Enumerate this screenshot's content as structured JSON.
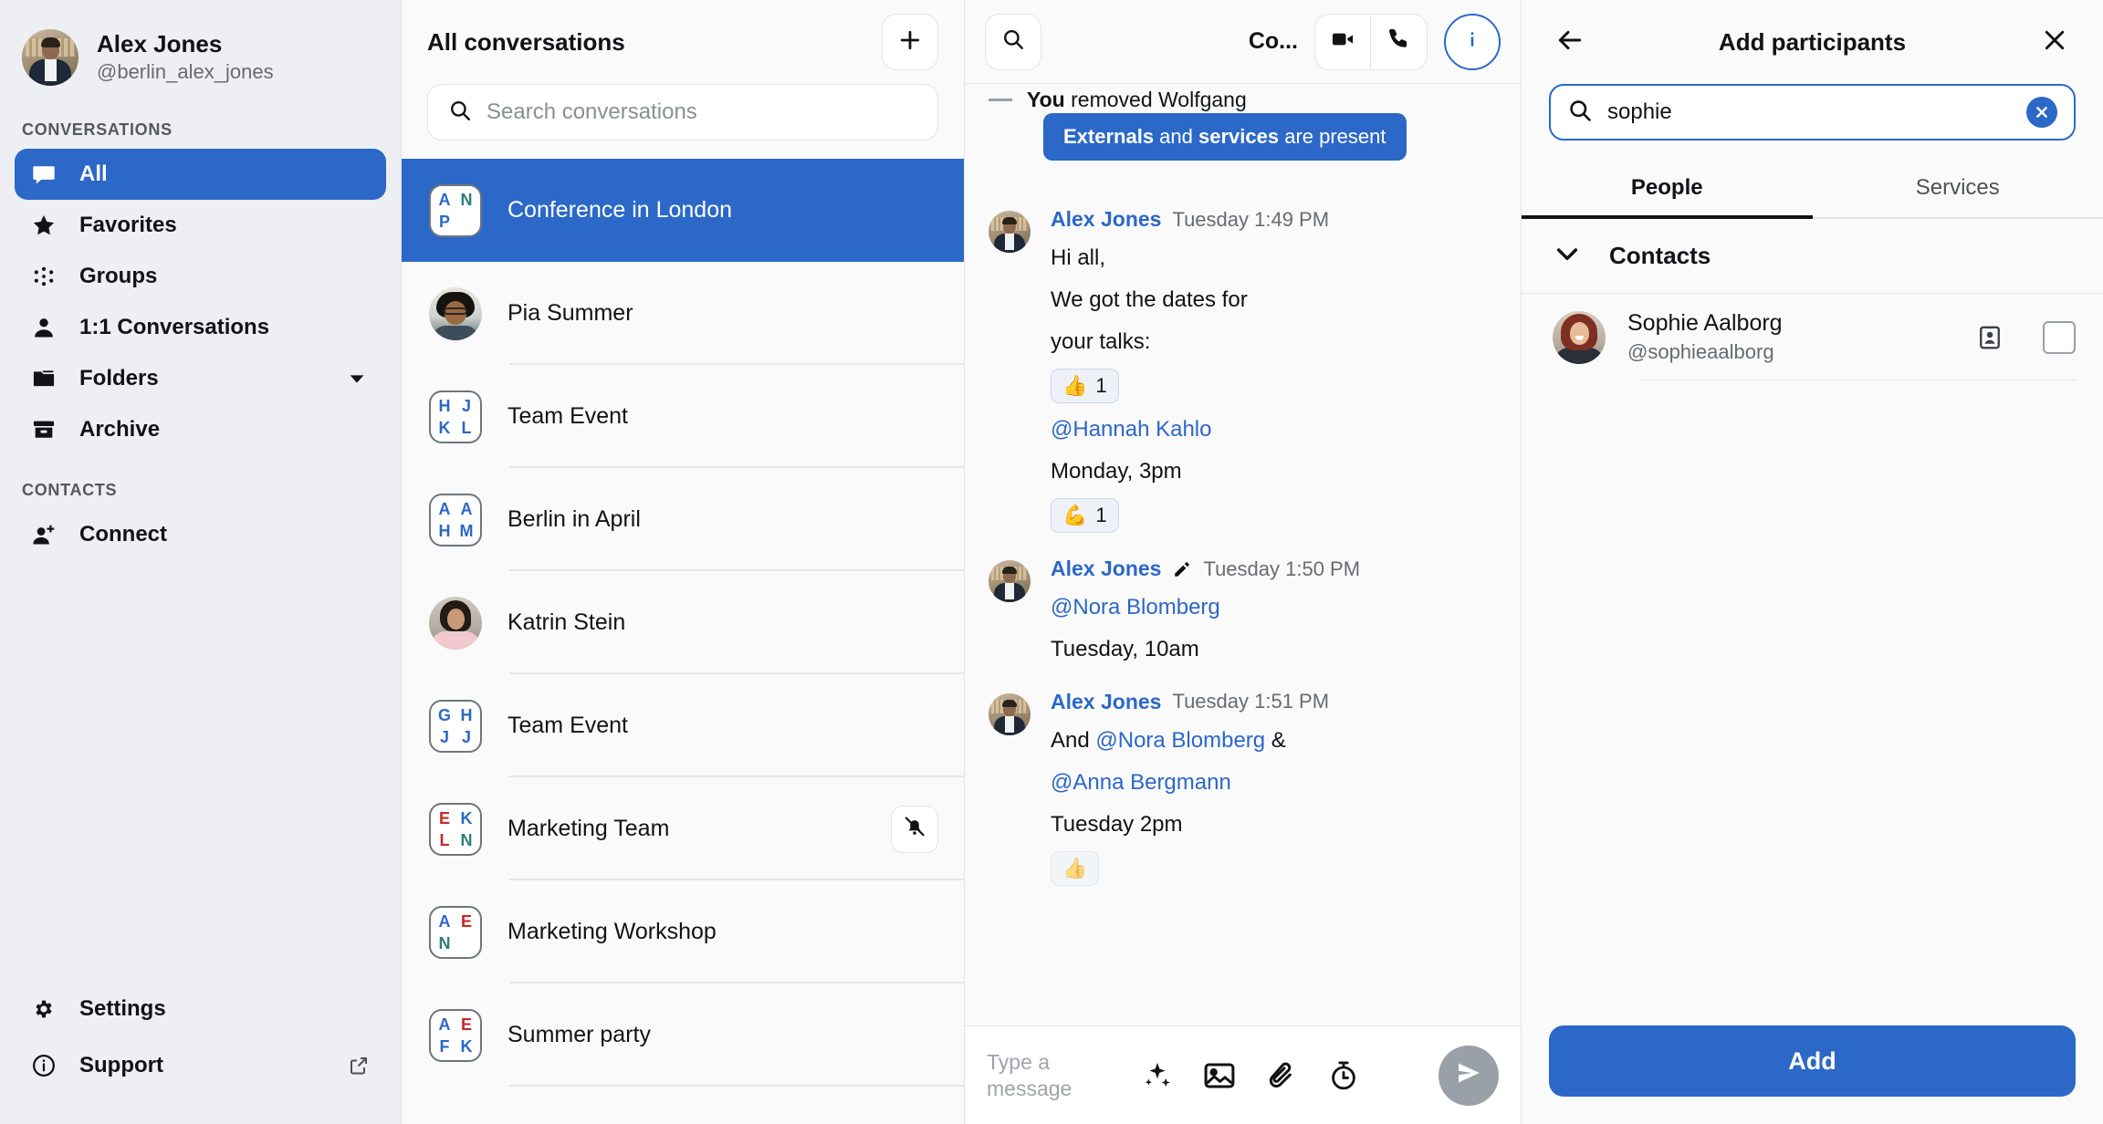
{
  "colors": {
    "accent": "#2b68c8",
    "sidebar_bg": "#edeff2",
    "panel_bg": "#fafafa",
    "muted_text": "#676b71"
  },
  "sidebar": {
    "profile": {
      "name": "Alex Jones",
      "handle": "@berlin_alex_jones",
      "avatar": "user-photo"
    },
    "conversations_label": "CONVERSATIONS",
    "contacts_label": "CONTACTS",
    "items": [
      {
        "label": "All",
        "icon": "chat-bubble-icon",
        "active": true
      },
      {
        "label": "Favorites",
        "icon": "star-icon",
        "active": false
      },
      {
        "label": "Groups",
        "icon": "groups-icon",
        "active": false
      },
      {
        "label": "1:1 Conversations",
        "icon": "person-icon",
        "active": false
      },
      {
        "label": "Folders",
        "icon": "folder-icon",
        "active": false,
        "chevron": "chevron-down-icon"
      },
      {
        "label": "Archive",
        "icon": "archive-icon",
        "active": false
      }
    ],
    "contacts_items": [
      {
        "label": "Connect",
        "icon": "person-add-icon"
      }
    ],
    "bottom_items": [
      {
        "label": "Settings",
        "icon": "gear-icon"
      },
      {
        "label": "Support",
        "icon": "info-circle-icon",
        "external": "external-link-icon"
      }
    ]
  },
  "convlist": {
    "title": "All conversations",
    "add_button": "plus-icon",
    "search": {
      "placeholder": "Search conversations",
      "value": "",
      "icon": "search-icon"
    },
    "items": [
      {
        "name": "Conference in London",
        "avatar_type": "initials",
        "initials": [
          "A",
          "N",
          "P"
        ],
        "initial_colors": [
          "#2b68c8",
          "#2e7d7a",
          "#2b68c8"
        ],
        "selected": true
      },
      {
        "name": "Pia Summer",
        "avatar_type": "photo",
        "photo": "pia-avatar",
        "selected": false
      },
      {
        "name": "Team Event",
        "avatar_type": "initials",
        "initials": [
          "H",
          "J",
          "K",
          "L"
        ],
        "initial_colors": [
          "#2b68c8",
          "#2b68c8",
          "#2b68c8",
          "#2b68c8"
        ],
        "selected": false
      },
      {
        "name": "Berlin in April",
        "avatar_type": "initials",
        "initials": [
          "A",
          "A",
          "H",
          "M"
        ],
        "initial_colors": [
          "#2b68c8",
          "#2b68c8",
          "#2b68c8",
          "#2b68c8"
        ],
        "selected": false
      },
      {
        "name": "Katrin Stein",
        "avatar_type": "photo",
        "photo": "katrin-avatar",
        "selected": false
      },
      {
        "name": "Team Event",
        "avatar_type": "initials",
        "initials": [
          "G",
          "H",
          "J",
          "J"
        ],
        "initial_colors": [
          "#2b68c8",
          "#2b68c8",
          "#2b68c8",
          "#2b68c8"
        ],
        "selected": false
      },
      {
        "name": "Marketing Team",
        "avatar_type": "initials",
        "initials": [
          "E",
          "K",
          "L",
          "N"
        ],
        "initial_colors": [
          "#c62828",
          "#2b68c8",
          "#c62828",
          "#2e7d7a"
        ],
        "selected": false,
        "muted": true,
        "mute_icon": "bell-off-icon"
      },
      {
        "name": "Marketing Workshop",
        "avatar_type": "initials",
        "initials": [
          "A",
          "E",
          "N"
        ],
        "initial_colors": [
          "#2b68c8",
          "#c62828",
          "#2e7d7a"
        ],
        "selected": false
      },
      {
        "name": "Summer party",
        "avatar_type": "initials",
        "initials": [
          "A",
          "E",
          "F",
          "K"
        ],
        "initial_colors": [
          "#2b68c8",
          "#c62828",
          "#2b68c8",
          "#2b68c8"
        ],
        "selected": false
      }
    ]
  },
  "chat": {
    "header": {
      "search_icon": "search-icon",
      "title": "Co...",
      "video_call_icon": "video-camera-icon",
      "audio_call_icon": "phone-icon",
      "info_icon": "info-circle-icon"
    },
    "system_message": {
      "prefix": "You",
      "rest": " removed Wolfgang"
    },
    "banner": {
      "bold1": "Externals",
      "mid": " and ",
      "bold2": "services",
      "tail": " are present"
    },
    "messages": [
      {
        "sender": "Alex Jones",
        "time": "Tuesday 1:49 PM",
        "edited": false,
        "lines": [
          {
            "type": "text",
            "text": "Hi all,"
          },
          {
            "type": "text",
            "text": "We got the dates for"
          },
          {
            "type": "text",
            "text": "your talks:"
          },
          {
            "type": "reaction",
            "emoji": "👍",
            "count": "1"
          },
          {
            "type": "mention",
            "text": "@Hannah Kahlo"
          },
          {
            "type": "text",
            "text": "Monday, 3pm"
          },
          {
            "type": "reaction",
            "emoji": "💪",
            "count": "1"
          }
        ]
      },
      {
        "sender": "Alex Jones",
        "time": "Tuesday 1:50 PM",
        "edited": true,
        "edit_icon": "pencil-icon",
        "lines": [
          {
            "type": "mention",
            "text": "@Nora Blomberg"
          },
          {
            "type": "text",
            "text": "Tuesday, 10am"
          }
        ]
      },
      {
        "sender": "Alex Jones",
        "time": "Tuesday 1:51 PM",
        "edited": false,
        "lines": [
          {
            "type": "mixed",
            "pre": "And ",
            "mention": "@Nora Blomberg",
            "post": " &"
          },
          {
            "type": "mention",
            "text": "@Anna Bergmann"
          },
          {
            "type": "text",
            "text": "Tuesday 2pm"
          }
        ]
      }
    ],
    "composer": {
      "placeholder_line1": "Type a",
      "placeholder_line2": "message",
      "icons": [
        "emoji-sparkle-icon",
        "image-icon",
        "paperclip-icon",
        "timer-icon"
      ],
      "send_icon": "send-icon"
    }
  },
  "right_panel": {
    "back_icon": "arrow-left-icon",
    "title": "Add participants",
    "close_icon": "close-icon",
    "search": {
      "value": "sophie",
      "icon": "search-icon",
      "clear_icon": "clear-circle-icon"
    },
    "tabs": [
      {
        "label": "People",
        "active": true
      },
      {
        "label": "Services",
        "active": false
      }
    ],
    "group": {
      "label": "Contacts",
      "chevron": "chevron-down-icon"
    },
    "people": [
      {
        "name": "Sophie Aalborg",
        "handle": "@sophieaalborg",
        "avatar": "sophie-avatar",
        "card_icon": "contact-card-icon",
        "checkbox_icon": "checkbox-unchecked-icon",
        "checked": false
      }
    ],
    "add_button": "Add"
  }
}
